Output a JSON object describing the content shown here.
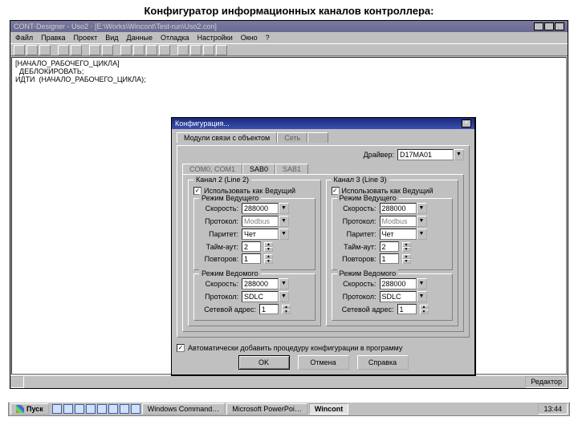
{
  "page_heading": "Конфигуратор информационных каналов контроллера:",
  "app_title": "CONT-Designer - Uso2 · [E:\\Works\\Wincont\\Test-run\\Uso2.con]",
  "menu": [
    "Файл",
    "Правка",
    "Проект",
    "Вид",
    "Данные",
    "Отладка",
    "Настройки",
    "Окно",
    "?"
  ],
  "editor_lines": [
    "[НАЧАЛО_РАБОЧЕГО_ЦИКЛА]",
    "  ДЕБЛОКИРОВАТЬ;",
    "ИДТИ  (НАЧАЛО_РАБОЧЕГО_ЦИКЛА);"
  ],
  "status_right": "Редактор",
  "dialog": {
    "title": "Конфигурация...",
    "top_tabs": [
      "Модули связи с объектом",
      "Сеть"
    ],
    "driver_label": "Драйвер:",
    "driver_value": "D17MA01",
    "sub_tabs": [
      "COM0, COM1",
      "SAB0",
      "SAB1"
    ],
    "channel2": {
      "title": "Канал 2 (Line 2)",
      "use_master": "Использовать как Ведущий",
      "master_title": "Режим Ведущего",
      "slave_title": "Режим Ведомого",
      "speed_label": "Скорость:",
      "speed_value": "288000",
      "proto_label": "Протокол:",
      "proto_value_master": "Modbus",
      "proto_value_slave": "SDLC",
      "parity_label": "Паритет:",
      "parity_value": "Чет",
      "timeout_label": "Тайм-аут:",
      "timeout_value": "2",
      "retries_label": "Повторов:",
      "retries_value": "1",
      "netaddr_label": "Сетевой адрес:",
      "netaddr_value": "1"
    },
    "channel3": {
      "title": "Канал 3 (Line 3)",
      "use_master": "Использовать как Ведущий",
      "master_title": "Режим Ведущего",
      "slave_title": "Режим Ведомого",
      "speed_label": "Скорость:",
      "speed_value": "288000",
      "proto_label": "Протокол:",
      "proto_value_master": "Modbus",
      "proto_value_slave": "SDLC",
      "parity_label": "Паритет:",
      "parity_value": "Чет",
      "timeout_label": "Тайм-аут:",
      "timeout_value": "2",
      "retries_label": "Повторов:",
      "retries_value": "1",
      "netaddr_label": "Сетевой адрес:",
      "netaddr_value": "1"
    },
    "auto_add": "Автоматически добавить процедуру конфигурации в программу",
    "ok": "OK",
    "cancel": "Отмена",
    "help": "Справка"
  },
  "taskbar": {
    "start": "Пуск",
    "items": [
      "Windows Command…",
      "Microsoft PowerPoi…",
      "Wincont"
    ],
    "clock": "13:44"
  }
}
